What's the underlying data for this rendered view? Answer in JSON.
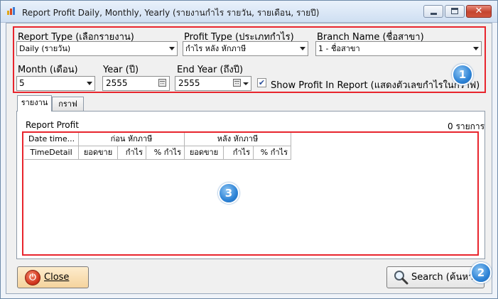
{
  "window": {
    "title": "Report Profit Daily, Monthly, Yearly (รายงานกำไร รายวัน, รายเดือน, รายปี)",
    "icon": "chart-app-icon",
    "controls": [
      "minimize-icon",
      "maximize-icon",
      "close-icon"
    ]
  },
  "filters": {
    "report_type": {
      "label": "Report Type (เลือกรายงาน)",
      "value": "Daily (รายวัน)"
    },
    "profit_type": {
      "label": "Profit Type (ประเภทกำไร)",
      "value": "กำไร หลัง หักภาษี"
    },
    "branch_name": {
      "label": "Branch Name (ชื่อสาขา)",
      "value": "1 - ชื่อสาขา"
    },
    "month": {
      "label": "Month (เดือน)",
      "value": "5"
    },
    "year": {
      "label": "Year (ปี)",
      "value": "2555"
    },
    "end_year": {
      "label": "End Year (ถึงปี)",
      "value": "2555"
    },
    "show_profit": {
      "label": "Show Profit In Report (แสดงตัวเลขกำไรในกราฟ)",
      "checked": true
    }
  },
  "tabs": [
    {
      "label": "รายงาน",
      "active": true
    },
    {
      "label": "กราฟ",
      "active": false
    }
  ],
  "report": {
    "title": "Report Profit",
    "count": "0 รายการ",
    "group_headers": [
      "Date time...",
      "ก่อน หักภาษี",
      "หลัง หักภาษี"
    ],
    "sub_headers": [
      "TimeDetail",
      "ยอดขาย",
      "กำไร",
      "% กำไร",
      "ยอดขาย",
      "กำไร",
      "% กำไร"
    ],
    "rows": []
  },
  "buttons": {
    "close": "Close",
    "search": "Search (ค้นหา)"
  },
  "annotations": [
    "1",
    "2",
    "3"
  ],
  "colors": {
    "highlight": "#e8252d",
    "badge": "#2d83d6",
    "close_button": "#f5d39d",
    "title_bar": "#cfdff2"
  }
}
